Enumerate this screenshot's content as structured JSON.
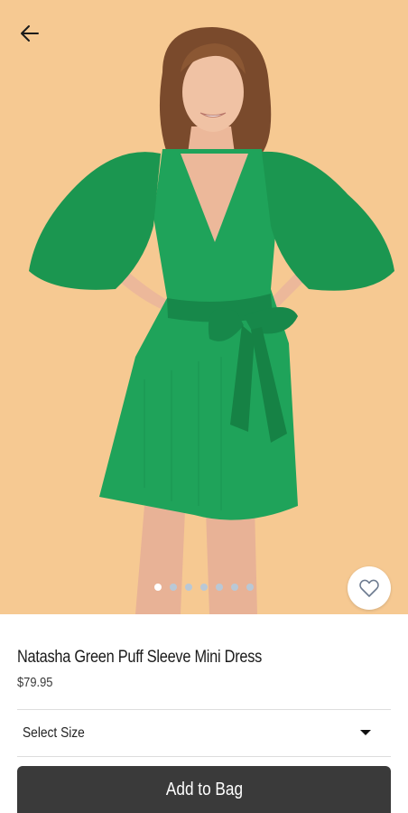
{
  "product": {
    "title": "Natasha Green Puff Sleeve Mini Dress",
    "price": "$79.95"
  },
  "gallery": {
    "image_count": 7,
    "active_index": 0,
    "background_color": "#f6c992",
    "dress_color": "#1fa35a"
  },
  "icons": {
    "back": "back-arrow-icon",
    "favorite": "heart-outline-icon",
    "dropdown": "caret-down-icon"
  },
  "size_selector": {
    "label": "Select Size"
  },
  "actions": {
    "add_to_bag": "Add to Bag"
  }
}
